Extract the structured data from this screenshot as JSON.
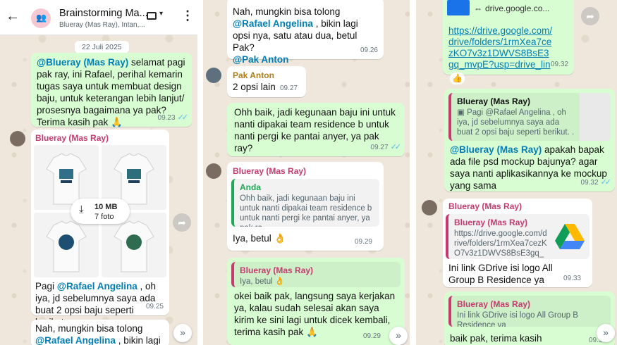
{
  "header": {
    "back_icon": "back-arrow-icon",
    "group_name": "Brainstorming Ma...",
    "members": "Blueray (Mas Ray), Intan,...",
    "video_icon": "video-camera-icon",
    "menu_icon": "more-vert-icon"
  },
  "panel1": {
    "date_chip": "22 Juli 2025",
    "msg1": {
      "mention": "@Blueray (Mas Ray)",
      "text": " selamat pagi pak ray, ini Rafael, perihal kemarin tugas saya untuk membuat design baju, untuk keterangan lebih lanjut/ prosesnya bagaimana ya pak? Terima kasih pak 🙏",
      "time": "09.23"
    },
    "msg2": {
      "sender": "Blueray (Mas Ray)",
      "download_size": "10 MB",
      "download_count": "7 foto",
      "caption_start": "Pagi ",
      "mention": "@Rafael Angelina",
      "caption_rest": " , oh iya, jd sebelumnya saya ada buat 2 opsi baju seperti berikut. . .",
      "time": "09.25"
    },
    "msg3": {
      "text_a": "Nah, mungkin bisa tolong",
      "mention": "@Rafael Angelina",
      "text_b": " , bikin lagi opsi"
    }
  },
  "panel2": {
    "msg1": {
      "text_a": "Nah, mungkin bisa tolong",
      "mention": "@Rafael Angelina",
      "text_b": " , bikin lagi opsi nya, satu atau dua, betul Pak?",
      "mention2": "@Pak Anton",
      "time": "09.26"
    },
    "msg2": {
      "sender": "Pak Anton",
      "text": "2 opsi lain",
      "time": "09.27"
    },
    "msg3": {
      "text": "Ohh baik, jadi kegunaan baju ini untuk nanti dipakai team residence b untuk nanti pergi ke pantai anyer, ya pak ray?",
      "time": "09.27"
    },
    "msg4": {
      "sender": "Blueray (Mas Ray)",
      "quote_sender": "Anda",
      "quote_text": "Ohh baik, jadi kegunaan baju ini untuk nanti dipakai team residence b untuk nanti pergi ke pantai anyer, ya pak ra...",
      "text": "Iya, betul 👌",
      "time": "09.29"
    },
    "msg5": {
      "quote_sender": "Blueray (Mas Ray)",
      "quote_text": "Iya, betul 👌",
      "text": "okei baik pak, langsung saya kerjakan ya, kalau sudah selesai akan saya kirim ke sini lagi untuk dicek kembali, terima kasih pak 🙏",
      "time": "09.29"
    }
  },
  "panel3": {
    "msg1": {
      "domain": "drive.google.co...",
      "link": "https://drive.google.com/drive/folders/1rmXea7cezKO7v3z1DWVS8BsE3gq_mvpE?usp=drive_link",
      "reaction": "👍",
      "time": "09.32"
    },
    "msg2": {
      "quote_sender": "Blueray (Mas Ray)",
      "quote_text": "Pagi @Rafael Angelina , oh iya, jd sebelumnya saya ada buat 2 opsi baju seperti berikut. . .",
      "mention": "@Blueray (Mas Ray)",
      "text": " apakah bapak ada file psd mockup bajunya? agar saya nanti aplikasikannya ke mockup yang sama",
      "time": "09.32"
    },
    "msg3": {
      "sender": "Blueray (Mas Ray)",
      "preview_title": "Blueray (Mas Ray)",
      "preview_link": "https://drive.google.com/drive/folders/1rmXea7cezKO7v3z1DWVS8BsE3gq_m...",
      "text": "Ini link GDrive isi logo All Group B Residence ya",
      "time": "09.33"
    },
    "msg4": {
      "quote_sender": "Blueray (Mas Ray)",
      "quote_text": "Ini link GDrive isi logo All Group B Residence ya",
      "text": "baik pak, terima kasih",
      "time": "09.33"
    }
  },
  "colors": {
    "outgoing": "#d9fdd3",
    "incoming": "#ffffff",
    "mention": "#027eb5",
    "sender_pink": "#c63a6f",
    "sender_gold": "#b07d1a",
    "tick": "#53bdeb"
  }
}
